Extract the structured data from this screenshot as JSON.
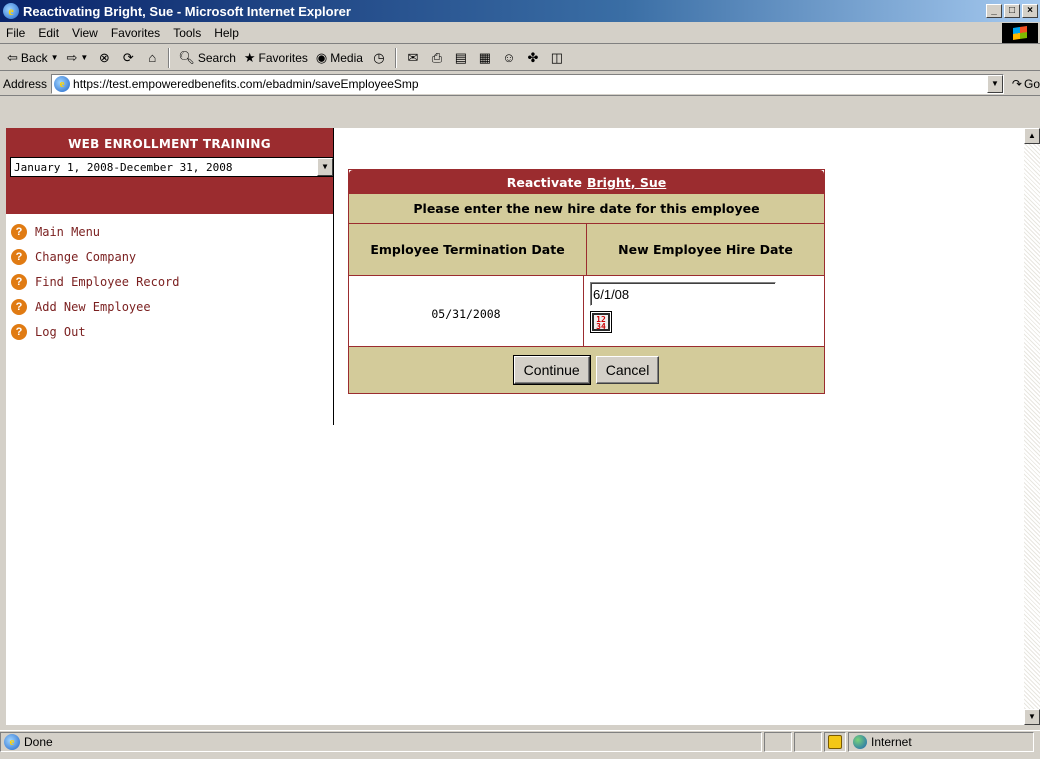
{
  "window": {
    "title": "Reactivating Bright, Sue - Microsoft Internet Explorer",
    "buttons": {
      "minimize": "_",
      "maximize": "□",
      "close": "×"
    }
  },
  "menu": [
    "File",
    "Edit",
    "View",
    "Favorites",
    "Tools",
    "Help"
  ],
  "toolbar": {
    "back": "Back",
    "search": "Search",
    "favorites": "Favorites",
    "media": "Media"
  },
  "address": {
    "label": "Address",
    "url": "https://test.empoweredbenefits.com/ebadmin/saveEmployeeSmp",
    "go": "Go"
  },
  "sidebar": {
    "title": "WEB ENROLLMENT TRAINING",
    "period": "January 1, 2008-December 31, 2008",
    "nav": [
      {
        "label": "Main Menu"
      },
      {
        "label": "Change Company"
      },
      {
        "label": "Find Employee Record"
      },
      {
        "label": "Add New Employee"
      },
      {
        "label": "Log Out"
      }
    ]
  },
  "dialog": {
    "title_prefix": "Reactivate",
    "employee_name": "Bright, Sue",
    "instruction": "Please enter the new hire date for this employee",
    "col_termination": "Employee Termination Date",
    "col_hire": "New Employee Hire Date",
    "termination_date": "05/31/2008",
    "hire_date_value": "6/1/08",
    "calendar_glyph": "12\n34",
    "continue_label": "Continue",
    "cancel_label": "Cancel"
  },
  "status": {
    "text": "Done",
    "zone": "Internet"
  },
  "colors": {
    "brand_red": "#9b2c2f",
    "tan": "#d3cb9a",
    "link_red": "#7a1f1f",
    "help_orange": "#e07b13"
  }
}
